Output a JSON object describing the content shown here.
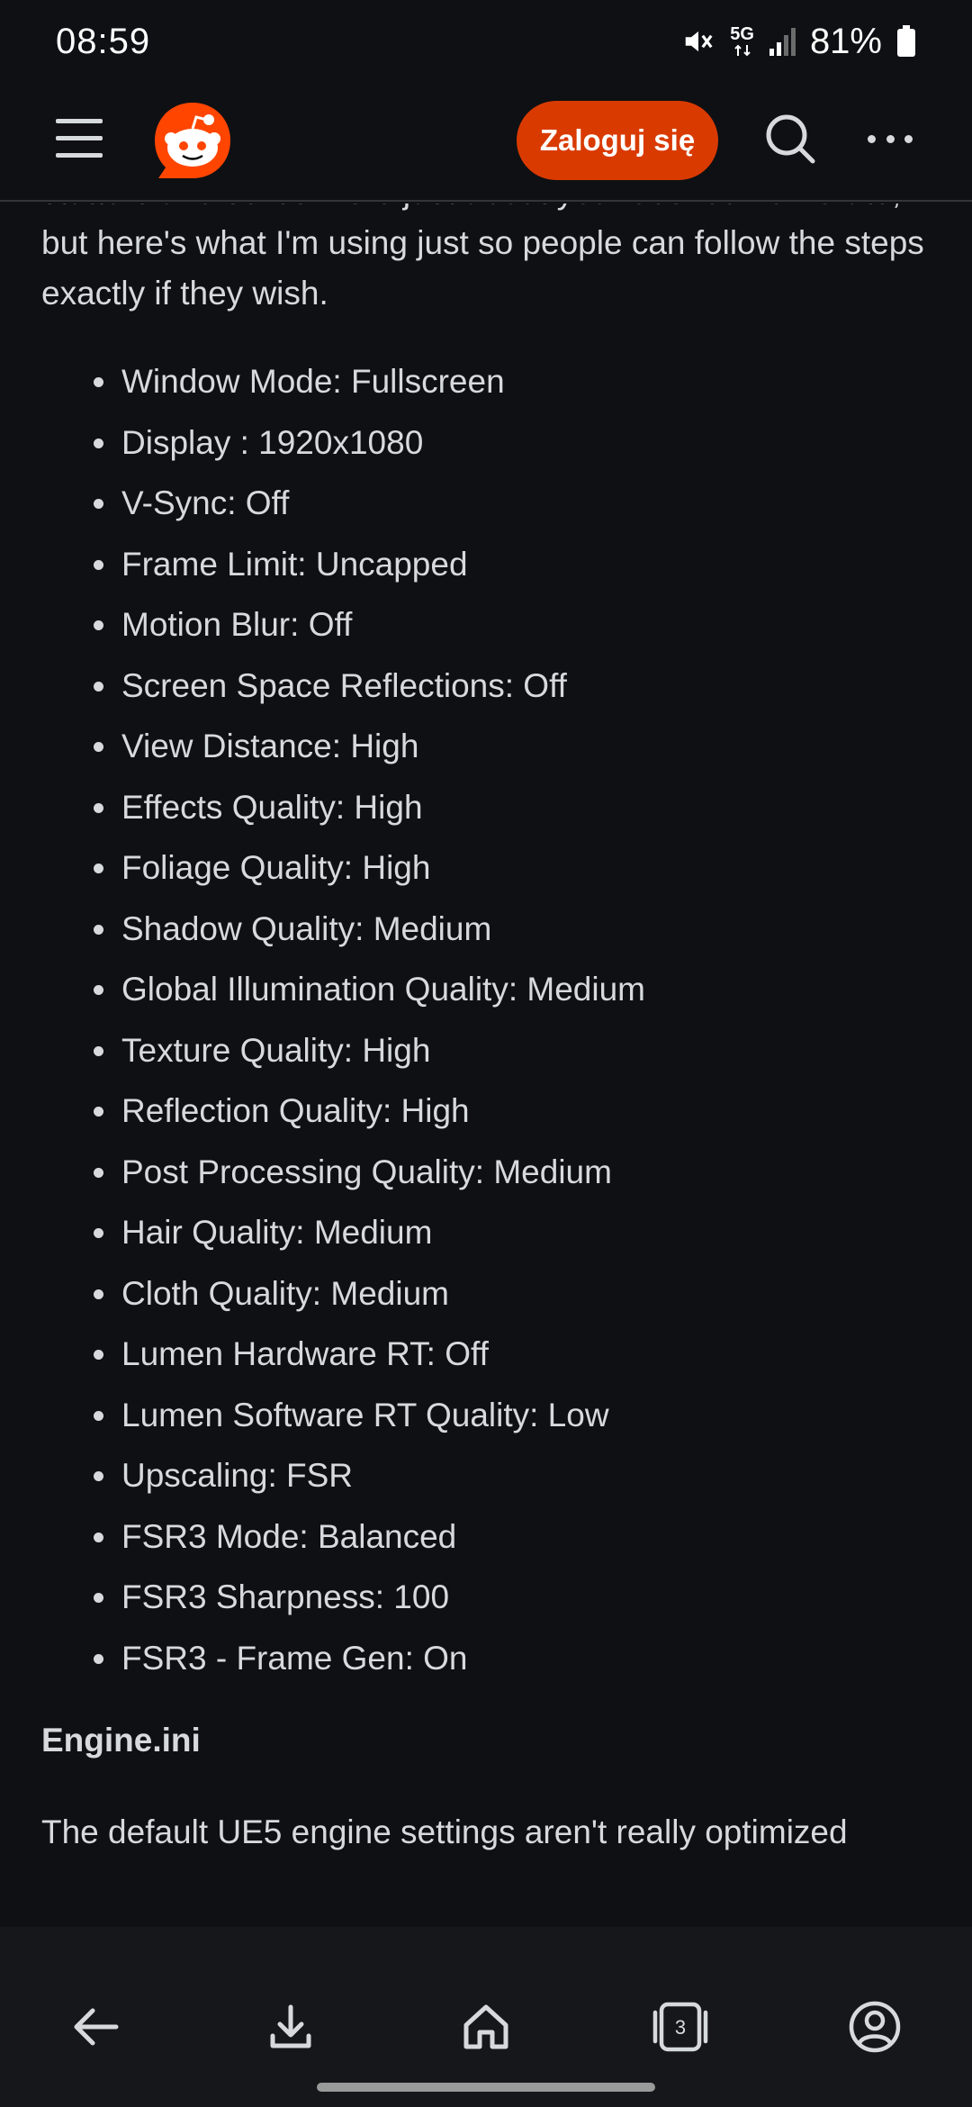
{
  "status_bar": {
    "time": "08:59",
    "network": "5G",
    "battery": "81%"
  },
  "header": {
    "login_label": "Zaloguj się",
    "icons": [
      "menu-icon",
      "reddit-logo",
      "search-icon",
      "more-icon"
    ]
  },
  "content": {
    "intro": "stutters and so it's more just about your desired framerate, but here's what I'm using just so people can follow the steps exactly if they wish.",
    "settings": [
      "Window Mode: Fullscreen",
      "Display : 1920x1080",
      "V-Sync: Off",
      "Frame Limit: Uncapped",
      "Motion Blur: Off",
      "Screen Space Reflections: Off",
      "View Distance: High",
      "Effects Quality: High",
      "Foliage Quality: High",
      "Shadow Quality: Medium",
      "Global Illumination Quality: Medium",
      "Texture Quality: High",
      "Reflection Quality: High",
      "Post Processing Quality: Medium",
      "Hair Quality: Medium",
      "Cloth Quality: Medium",
      "Lumen Hardware RT: Off",
      "Lumen Software RT Quality: Low",
      "Upscaling: FSR",
      "FSR3 Mode: Balanced",
      "FSR3 Sharpness: 100",
      "FSR3 - Frame Gen: On"
    ],
    "heading": "Engine.ini",
    "outro": "The default UE5 engine settings aren't really optimized"
  },
  "bottom_nav": {
    "tab_count": "3",
    "icons": [
      "back-arrow-icon",
      "download-icon",
      "home-icon",
      "tabs-icon",
      "profile-icon"
    ]
  },
  "colors": {
    "background": "#0e1014",
    "text": "#d7dadc",
    "accent": "#d93a00",
    "nav_background": "#16171b"
  }
}
